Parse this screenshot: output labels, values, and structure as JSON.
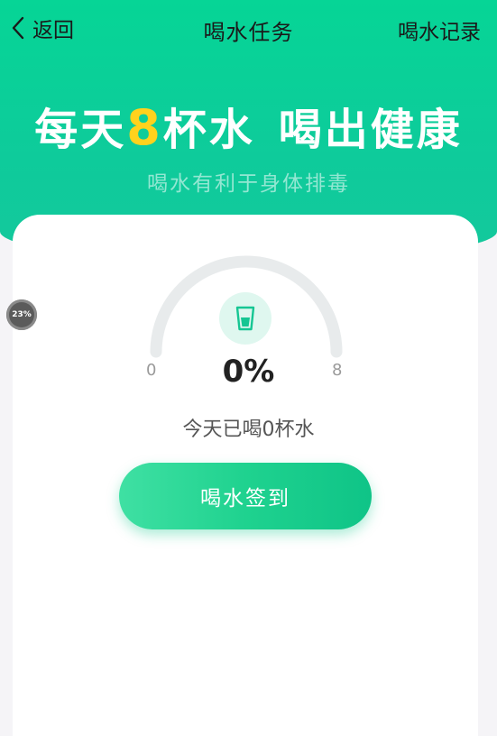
{
  "nav": {
    "back_label": "返回",
    "title": "喝水任务",
    "record_label": "喝水记录"
  },
  "hero": {
    "slogan_prefix": "每天",
    "slogan_highlight": "8",
    "slogan_middle": "杯水",
    "slogan_suffix": "喝出健康",
    "subtitle": "喝水有利于身体排毒",
    "accent_color": "#ffd21d",
    "brand_color": "#0ecb9b"
  },
  "progress": {
    "min_label": "0",
    "max_label": "8",
    "percent_label": "0%",
    "fraction": 0,
    "today_text": "今天已喝0杯水"
  },
  "actions": {
    "drink_button_label": "喝水签到"
  },
  "overlay": {
    "float_badge": "23%"
  }
}
